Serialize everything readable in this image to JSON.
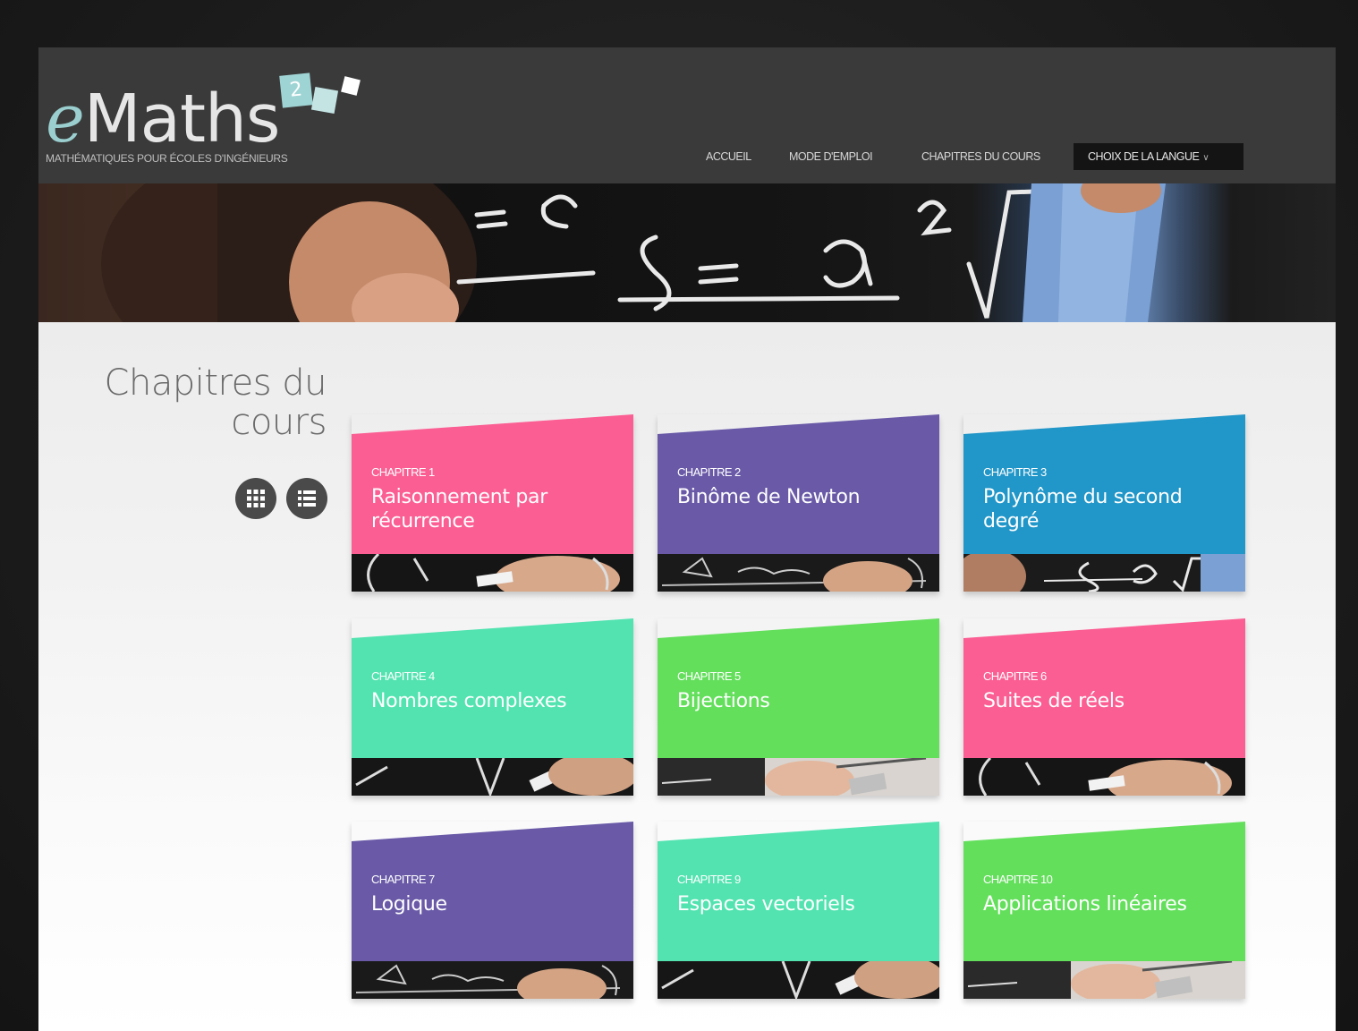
{
  "brand": {
    "logo_prefix": "e",
    "logo_rest": "Maths",
    "logo_badge": "2",
    "tagline": "MATHÉMATIQUES POUR ÉCOLES D'INGÉNIEURS"
  },
  "nav": {
    "items": [
      "ACCUEIL",
      "MODE D'EMPLOI",
      "CHAPITRES DU COURS"
    ],
    "language_label": "CHOIX DE LA LANGUE",
    "language_chevron": "∨"
  },
  "banner": {
    "formula_left": "= c²",
    "formula_right": "S = a²√"
  },
  "section": {
    "title_line1": "Chapitres du",
    "title_line2": "cours"
  },
  "view_toggle": {
    "grid_icon": "grid-icon",
    "list_icon": "list-icon"
  },
  "colors": {
    "pink": "#fb5e93",
    "purple": "#6959a7",
    "blue": "#2196c8",
    "mint": "#52e3b0",
    "green": "#63df5c"
  },
  "chapters": [
    {
      "label": "CHAPITRE 1",
      "title": "Raisonnement par récurrence",
      "color": "#fb5e93",
      "image": "chalk-hand-a"
    },
    {
      "label": "CHAPITRE 2",
      "title": "Binôme de Newton",
      "color": "#6959a7",
      "image": "chalk-formula"
    },
    {
      "label": "CHAPITRE 3",
      "title": "Polynôme du second degré",
      "color": "#2196c8",
      "image": "banner-formula"
    },
    {
      "label": "CHAPITRE 4",
      "title": "Nombres complexes",
      "color": "#52e3b0",
      "image": "chalk-hand-b"
    },
    {
      "label": "CHAPITRE 5",
      "title": "Bijections",
      "color": "#63df5c",
      "image": "light-hand"
    },
    {
      "label": "CHAPITRE 6",
      "title": "Suites de réels",
      "color": "#fb5e93",
      "image": "chalk-hand-a"
    },
    {
      "label": "CHAPITRE 7",
      "title": "Logique",
      "color": "#6959a7",
      "image": "chalk-formula"
    },
    {
      "label": "CHAPITRE 9",
      "title": "Espaces vectoriels",
      "color": "#52e3b0",
      "image": "chalk-hand-b"
    },
    {
      "label": "CHAPITRE 10",
      "title": "Applications linéaires",
      "color": "#63df5c",
      "image": "light-hand"
    }
  ]
}
